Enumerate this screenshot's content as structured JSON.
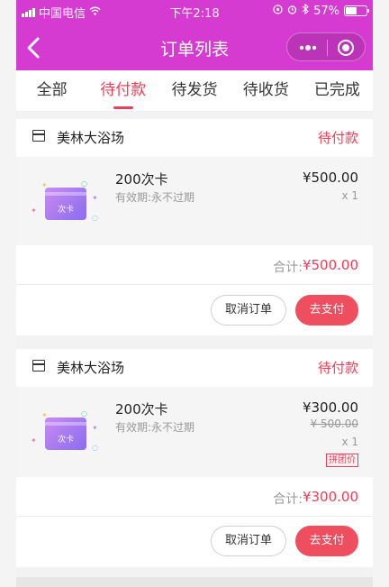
{
  "status_bar": {
    "carrier": "中国电信",
    "time": "下午2:18",
    "battery": "57%"
  },
  "nav": {
    "title": "订单列表",
    "back_icon": "chevron-left-icon",
    "more_icon": "more-dots-icon",
    "close_icon": "target-close-icon"
  },
  "colors": {
    "brand": "#d53bd0",
    "accent": "#e8405a"
  },
  "tabs": [
    {
      "label": "全部",
      "active": false
    },
    {
      "label": "待付款",
      "active": true
    },
    {
      "label": "待发货",
      "active": false
    },
    {
      "label": "待收货",
      "active": false
    },
    {
      "label": "已完成",
      "active": false
    }
  ],
  "orders": [
    {
      "shop": "美林大浴场",
      "status": "待付款",
      "item": {
        "thumb_label": "次卡",
        "name": "200次卡",
        "desc": "有效期:永不过期",
        "price": "¥500.00",
        "qty": "x 1"
      },
      "total_label": "合计:",
      "total": "¥500.00",
      "cancel_label": "取消订单",
      "pay_label": "去支付"
    },
    {
      "shop": "美林大浴场",
      "status": "待付款",
      "item": {
        "thumb_label": "次卡",
        "name": "200次卡",
        "desc": "有效期:永不过期",
        "price": "¥300.00",
        "old_price": "¥ 500.00",
        "qty": "x 1",
        "tag": "拼团价"
      },
      "total_label": "合计:",
      "total": "¥300.00",
      "cancel_label": "取消订单",
      "pay_label": "去支付"
    }
  ]
}
